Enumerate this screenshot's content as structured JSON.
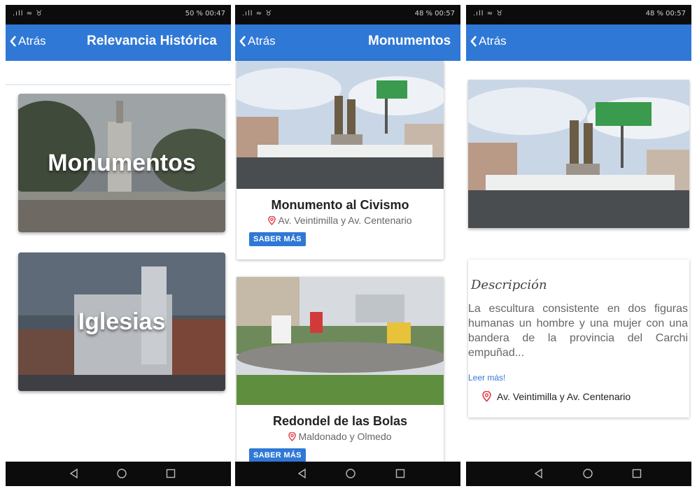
{
  "screen1": {
    "status_left": ".ıll ≈ ♉",
    "status_right": "50 % 00:47",
    "back_label": "Atrás",
    "title": "Relevancia Histórica",
    "categories": [
      {
        "label": "Monumentos"
      },
      {
        "label": "Iglesias"
      }
    ]
  },
  "screen2": {
    "status_left": ".ıll ≈ ♉",
    "status_right": "48 % 00:57",
    "back_label": "Atrás",
    "title": "Monumentos",
    "items": [
      {
        "name": "Monumento al Civismo",
        "address": "Av. Veintimilla y Av. Centenario",
        "button": "SABER MÁS"
      },
      {
        "name": "Redondel de las Bolas",
        "address": "Maldonado y Olmedo",
        "button": "SABER MÁS"
      }
    ]
  },
  "screen3": {
    "status_left": ".ıll ≈ ♉",
    "status_right": "48 % 00:57",
    "back_label": "Atrás",
    "description_heading": "Descripción",
    "description_text": "La escultura consistente en dos figuras humanas un hombre y una mujer con una bandera de la provincia del Carchi empuñad...",
    "read_more": "Leer más!",
    "location": "Av. Veintimilla y Av. Centenario"
  },
  "colors": {
    "accent": "#2f78d6",
    "status_bar": "#0c0c0c",
    "pin": "#e0404a"
  },
  "icons": [
    "back-chevron-icon",
    "location-pin-icon",
    "back-triangle-icon",
    "home-circle-icon",
    "recents-square-icon"
  ]
}
